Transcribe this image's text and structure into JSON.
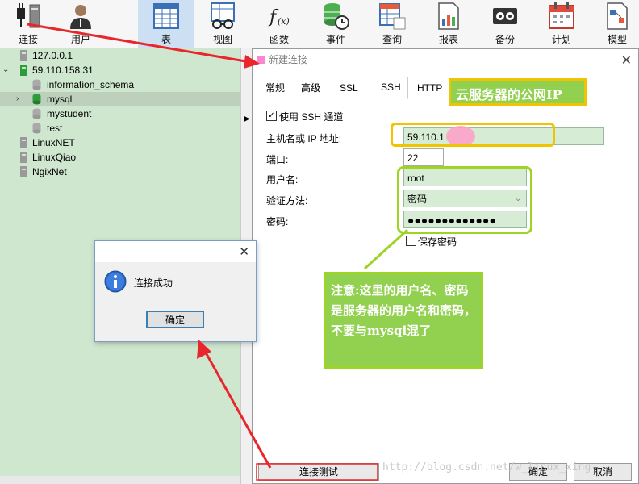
{
  "toolbar": {
    "buttons": [
      {
        "label": "连接",
        "icon": "plug-icon"
      },
      {
        "label": "用户",
        "icon": "user-icon"
      },
      {
        "label": "表",
        "icon": "table-icon"
      },
      {
        "label": "视图",
        "icon": "view-icon"
      },
      {
        "label": "函数",
        "icon": "function-icon"
      },
      {
        "label": "事件",
        "icon": "event-icon"
      },
      {
        "label": "查询",
        "icon": "query-icon"
      },
      {
        "label": "报表",
        "icon": "report-icon"
      },
      {
        "label": "备份",
        "icon": "backup-icon"
      },
      {
        "label": "计划",
        "icon": "calendar-icon"
      },
      {
        "label": "模型",
        "icon": "model-icon"
      }
    ],
    "active": "表"
  },
  "sidebar": {
    "items": [
      {
        "label": "127.0.0.1",
        "icon": "connection-icon",
        "level": 0
      },
      {
        "label": "59.110.158.31",
        "icon": "connection-icon",
        "level": 0,
        "expanded": true
      },
      {
        "label": "information_schema",
        "icon": "database-icon",
        "level": 1
      },
      {
        "label": "mysql",
        "icon": "database-icon",
        "level": 1,
        "selected": true
      },
      {
        "label": "mystudent",
        "icon": "database-icon",
        "level": 1
      },
      {
        "label": "test",
        "icon": "database-icon",
        "level": 1
      },
      {
        "label": "LinuxNET",
        "icon": "connection-icon",
        "level": 0
      },
      {
        "label": "LinuxQiao",
        "icon": "connection-icon",
        "level": 0
      },
      {
        "label": "NgixNet",
        "icon": "connection-icon",
        "level": 0
      }
    ]
  },
  "dialog": {
    "title": "新建连接",
    "tabs": [
      "常规",
      "高级",
      "SSL",
      "SSH",
      "HTTP"
    ],
    "active_tab": "SSH",
    "use_ssh_label": "使用 SSH 通道",
    "host_label": "主机名或 IP 地址:",
    "host_value": "59.110.1",
    "port_label": "端口:",
    "port_value": "22",
    "username_label": "用户名:",
    "username_value": "root",
    "auth_label": "验证方法:",
    "auth_value": "密码",
    "password_label": "密码:",
    "password_value": "●●●●●●●●●●●●●",
    "save_password_label": "保存密码",
    "test_button": "连接测试",
    "ok_button": "确定",
    "cancel_button": "取消"
  },
  "message_box": {
    "text": "连接成功",
    "ok_button": "确定"
  },
  "annotations": {
    "ip_note": "云服务器的公网IP",
    "user_note": "注意:这里的用户名、密码是服务器的用户名和密码，不要与mysql混了"
  },
  "watermark": "http://blog.csdn.net/w_linux_xing",
  "colors": {
    "arrow": "#e8262b",
    "ip_box": "#f0c400",
    "note_border": "#9ed424",
    "note_fill": "#92d050",
    "sidebar": "#cfe6cf",
    "field": "#d7ecd4"
  }
}
